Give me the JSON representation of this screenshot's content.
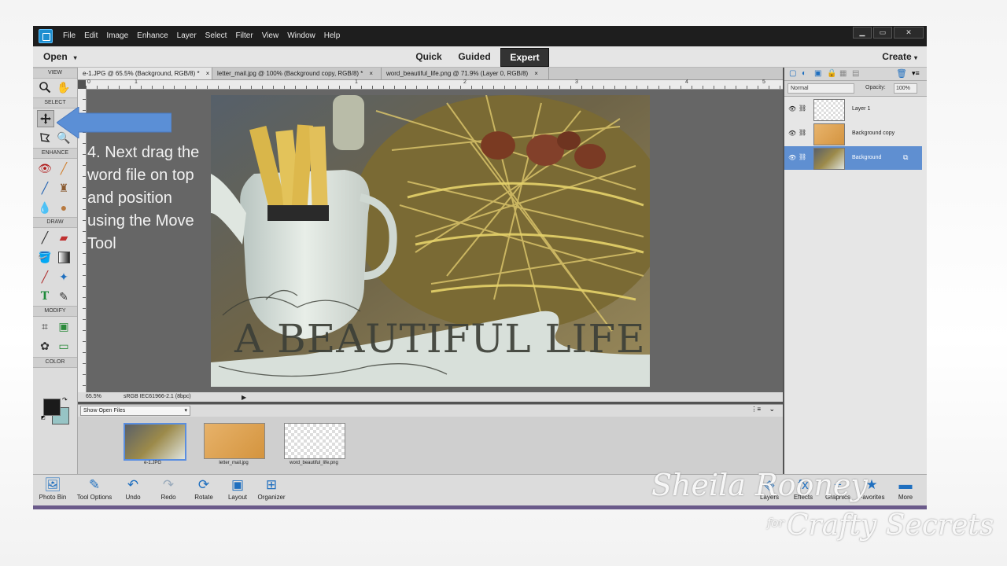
{
  "menubar": {
    "items": [
      "File",
      "Edit",
      "Image",
      "Enhance",
      "Layer",
      "Select",
      "Filter",
      "View",
      "Window",
      "Help"
    ],
    "window_buttons": [
      "▁",
      "▭",
      "✕"
    ]
  },
  "modebar": {
    "open_label": "Open",
    "tabs": [
      "Quick",
      "Guided",
      "Expert"
    ],
    "active_tab": "Expert",
    "create_label": "Create"
  },
  "toolbox": {
    "sections": [
      "VIEW",
      "SELECT",
      "ENHANCE",
      "DRAW",
      "MODIFY",
      "COLOR"
    ],
    "foreground_color": "#1a1a1a",
    "background_color": "#97c4c5"
  },
  "doc_tabs": [
    {
      "label": "e-1.JPG @ 65.5% (Background, RGB/8) *"
    },
    {
      "label": "letter_mail.jpg @ 100% (Background copy, RGB/8) *"
    },
    {
      "label": "word_beautiful_life.png @ 71.9% (Layer 0, RGB/8)"
    }
  ],
  "ruler_numbers": [
    "0",
    "1",
    "2",
    "3",
    "4",
    "5"
  ],
  "canvas": {
    "overlay_text": "A BEAUTIFUL LIFE"
  },
  "status": {
    "zoom": "65.5%",
    "profile": "sRGB IEC61966-2.1 (8bpc)"
  },
  "project_bin": {
    "dropdown": "Show Open Files",
    "thumbs": [
      "e-1.JPG",
      "letter_mail.jpg",
      "word_beautiful_life.png"
    ]
  },
  "layers_panel": {
    "blend_mode": "Normal",
    "opacity_label": "Opacity:",
    "opacity_value": "100%",
    "layers": [
      "Layer 1",
      "Background copy",
      "Background"
    ],
    "selected_layer": "Background"
  },
  "taskbar": {
    "left": [
      "Photo Bin",
      "Tool Options",
      "Undo",
      "Redo",
      "Rotate",
      "Layout",
      "Organizer"
    ],
    "right": [
      "Layers",
      "Effects",
      "Graphics",
      "Favorites",
      "More"
    ]
  },
  "instruction": "4. Next drag the word file on top and position using the Move Tool",
  "watermark": {
    "name": "Sheila Rooney",
    "for": "for",
    "brand": "Crafty Secrets"
  },
  "colors": {
    "arrow_fill": "#5b8fd6",
    "accent_selected_layer": "#5f8fd1"
  }
}
